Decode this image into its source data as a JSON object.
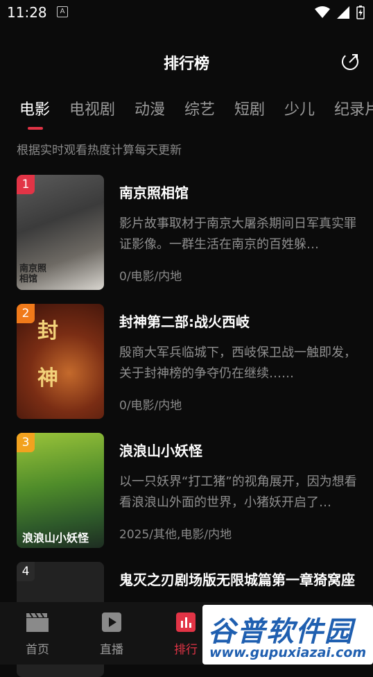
{
  "status": {
    "time": "11:28",
    "notif_badge": "A"
  },
  "header": {
    "title": "排行榜",
    "share_icon": "share-out-icon"
  },
  "tabs": [
    {
      "label": "电影",
      "active": true
    },
    {
      "label": "电视剧",
      "active": false
    },
    {
      "label": "动漫",
      "active": false
    },
    {
      "label": "综艺",
      "active": false
    },
    {
      "label": "短剧",
      "active": false
    },
    {
      "label": "少儿",
      "active": false
    },
    {
      "label": "纪录片",
      "active": false
    }
  ],
  "subtitle": "根据实时观看热度计算每天更新",
  "items": [
    {
      "rank": "1",
      "name": "南京照相馆",
      "desc": "影片故事取材于南京大屠杀期间日军真实罪证影像。一群生活在南京的百姓躲…",
      "meta": "0/电影/内地",
      "rank_color": "#e23446",
      "poster_text": "南京照相馆"
    },
    {
      "rank": "2",
      "name": "封神第二部:战火西岐",
      "desc": "殷商大军兵临城下，西岐保卫战一触即发，关于封神榜的争夺仍在继续……",
      "meta": "0/电影/内地",
      "rank_color": "#f07a1a",
      "poster_text": "封神"
    },
    {
      "rank": "3",
      "name": "浪浪山小妖怪",
      "desc": "以一只妖界“打工猪”的视角展开，因为想看看浪浪山外面的世界，小猪妖开启了…",
      "meta": "2025/其他,电影/内地",
      "rank_color": "#f2a21f",
      "poster_text": "浪浪山小妖怪"
    },
    {
      "rank": "4",
      "name": "鬼灭之刃剧场版无限城篇第一章猗窝座",
      "desc": "",
      "meta": "",
      "rank_color": "#2a2a2a",
      "poster_text": ""
    }
  ],
  "bottom_nav": [
    {
      "label": "首页",
      "icon": "clapperboard-icon",
      "active": false
    },
    {
      "label": "直播",
      "icon": "play-icon",
      "active": false
    },
    {
      "label": "排行",
      "icon": "bar-chart-icon",
      "active": true
    }
  ],
  "watermark": {
    "title": "谷普软件园",
    "url": "www.gupuxiazai.com"
  }
}
